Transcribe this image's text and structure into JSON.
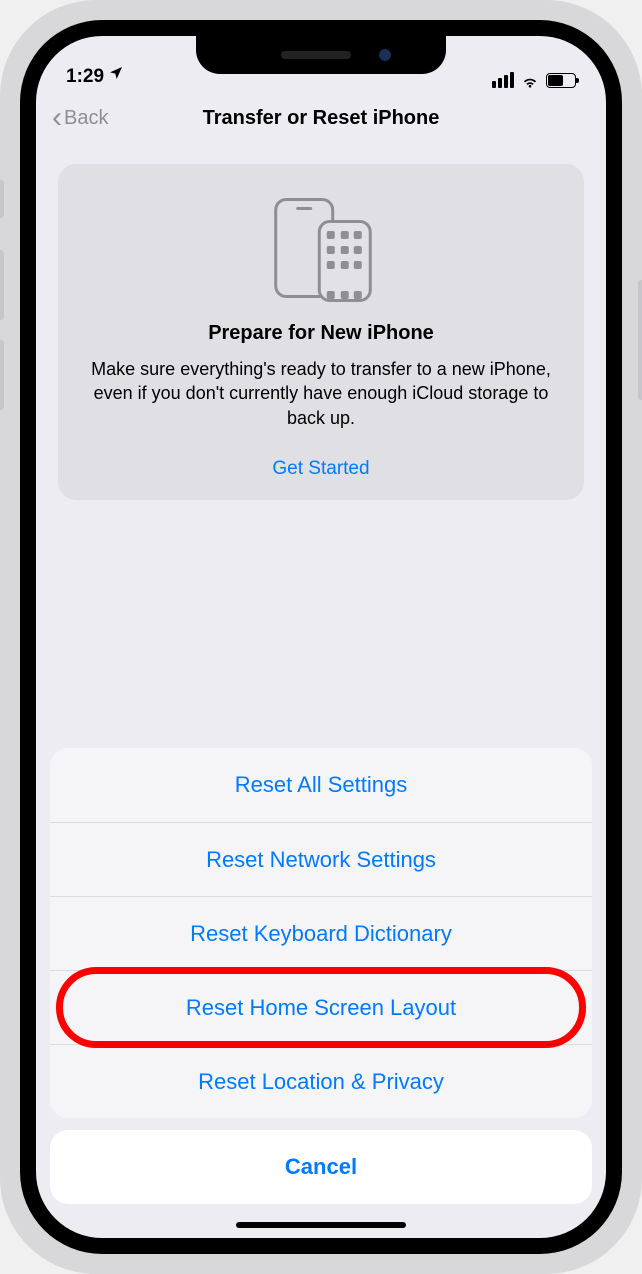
{
  "status": {
    "time": "1:29",
    "location_icon": "location-icon"
  },
  "nav": {
    "back_label": "Back",
    "title": "Transfer or Reset iPhone"
  },
  "prepare_card": {
    "title": "Prepare for New iPhone",
    "description": "Make sure everything's ready to transfer to a new iPhone, even if you don't currently have enough iCloud storage to back up.",
    "cta": "Get Started"
  },
  "reset_sheet": {
    "items": [
      "Reset All Settings",
      "Reset Network Settings",
      "Reset Keyboard Dictionary",
      "Reset Home Screen Layout",
      "Reset Location & Privacy"
    ],
    "highlighted_index": 3,
    "cancel": "Cancel"
  }
}
